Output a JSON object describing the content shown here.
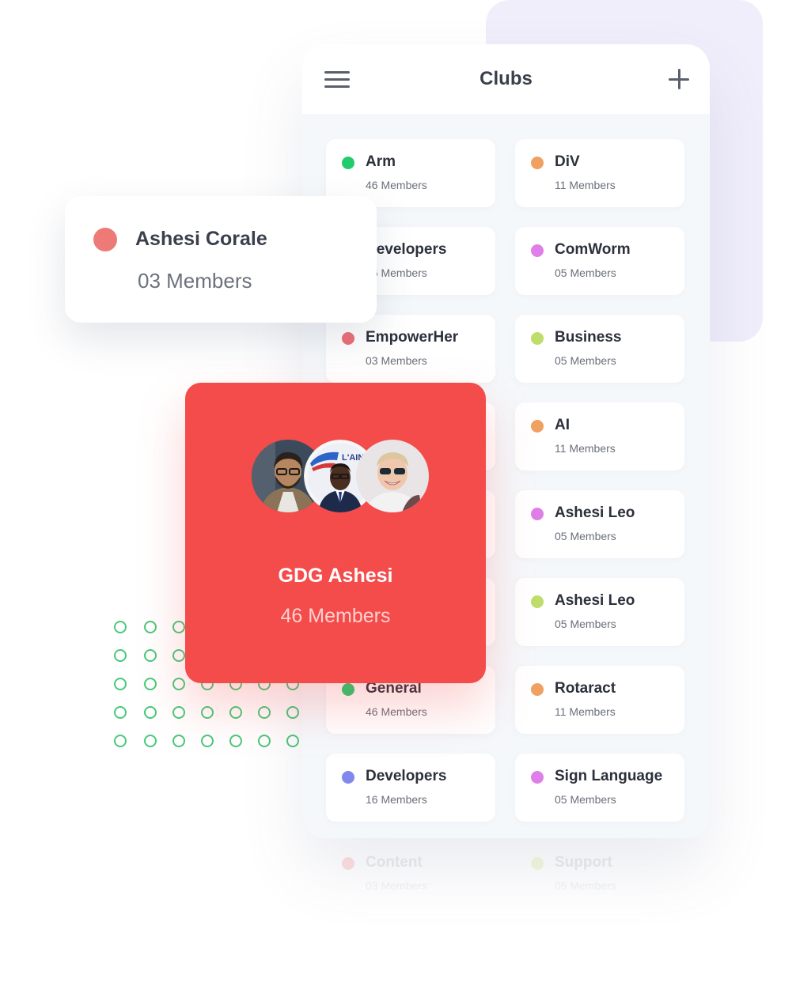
{
  "app": {
    "title": "Clubs"
  },
  "clubs": [
    {
      "name": "Arm",
      "members": "46 Members",
      "color": "#22cc6e"
    },
    {
      "name": "DiV",
      "members": "11 Members",
      "color": "#f0a060"
    },
    {
      "name": "Developers",
      "members": "16 Members",
      "color": "#8088ee"
    },
    {
      "name": "ComWorm",
      "members": "05 Members",
      "color": "#e07ee8"
    },
    {
      "name": "EmpowerHer",
      "members": "03 Members",
      "color": "#ee6e78"
    },
    {
      "name": "Business",
      "members": "05 Members",
      "color": "#bfdd6a"
    },
    {
      "name": "AI",
      "members": "11 Members",
      "color": "#f0a060"
    },
    {
      "name": "Ashesi Leo",
      "members": "05 Members",
      "color": "#e07ee8"
    },
    {
      "name": "Ashesi Leo",
      "members": "05 Members",
      "color": "#bfdd6a"
    },
    {
      "name": "General",
      "members": "46 Members",
      "color": "#22cc6e"
    },
    {
      "name": "Rotaract",
      "members": "11 Members",
      "color": "#f0a060"
    },
    {
      "name": "Developers",
      "members": "16 Members",
      "color": "#8088ee"
    },
    {
      "name": "Sign Language",
      "members": "05 Members",
      "color": "#e07ee8"
    }
  ],
  "faded_clubs": [
    {
      "name": "Content",
      "members": "03 Members",
      "color": "#ee6e78"
    },
    {
      "name": "Support",
      "members": "05 Members",
      "color": "#bfdd6a"
    }
  ],
  "corale_card": {
    "name": "Ashesi Corale",
    "members": "03 Members",
    "color": "#ee7a78"
  },
  "gdg_card": {
    "name": "GDG Ashesi",
    "members": "46 Members",
    "color": "#f44b4b",
    "avatars": [
      "member-avatar-1",
      "member-avatar-2",
      "member-avatar-3"
    ],
    "logo_text": "L'AINÉ"
  },
  "decor": {
    "dot_color": "#47c97a",
    "lavender": "#f0eefb"
  }
}
